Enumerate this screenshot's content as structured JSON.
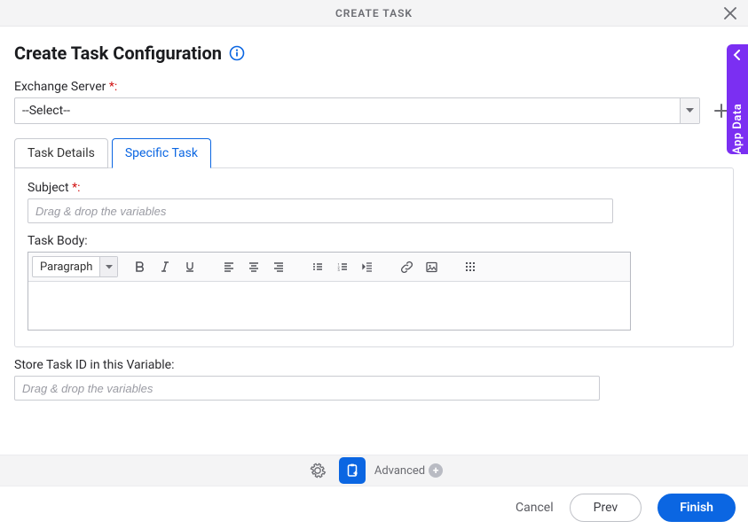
{
  "header": {
    "title": "CREATE TASK"
  },
  "page": {
    "heading": "Create Task Configuration"
  },
  "fields": {
    "exchange": {
      "label": "Exchange Server",
      "required_suffix": "*:",
      "value": "--Select--"
    },
    "subject": {
      "label": "Subject",
      "required_suffix": "*:",
      "placeholder": "Drag & drop the variables"
    },
    "body": {
      "label": "Task Body:"
    },
    "store": {
      "label": "Store Task ID in this Variable:",
      "placeholder": "Drag & drop the variables"
    }
  },
  "tabs": {
    "details": "Task Details",
    "specific": "Specific Task"
  },
  "editor": {
    "paragraph_label": "Paragraph"
  },
  "footer": {
    "advanced": "Advanced"
  },
  "actions": {
    "cancel": "Cancel",
    "prev": "Prev",
    "finish": "Finish"
  },
  "side_panel": {
    "label": "App Data"
  },
  "icons": {
    "close": "close-icon",
    "info": "info-icon",
    "caret": "caret-down-icon",
    "plus": "plus-icon",
    "bold": "bold-icon",
    "italic": "italic-icon",
    "underline": "underline-icon",
    "align_left": "align-left-icon",
    "align_center": "align-center-icon",
    "align_right": "align-right-icon",
    "list_ul": "list-ul-icon",
    "list_ol": "list-ol-icon",
    "outdent": "outdent-icon",
    "link": "link-icon",
    "image": "image-icon",
    "grid": "grid-icon",
    "gear": "gear-icon",
    "clipboard": "clipboard-icon",
    "chevron_left": "chevron-left-icon"
  }
}
